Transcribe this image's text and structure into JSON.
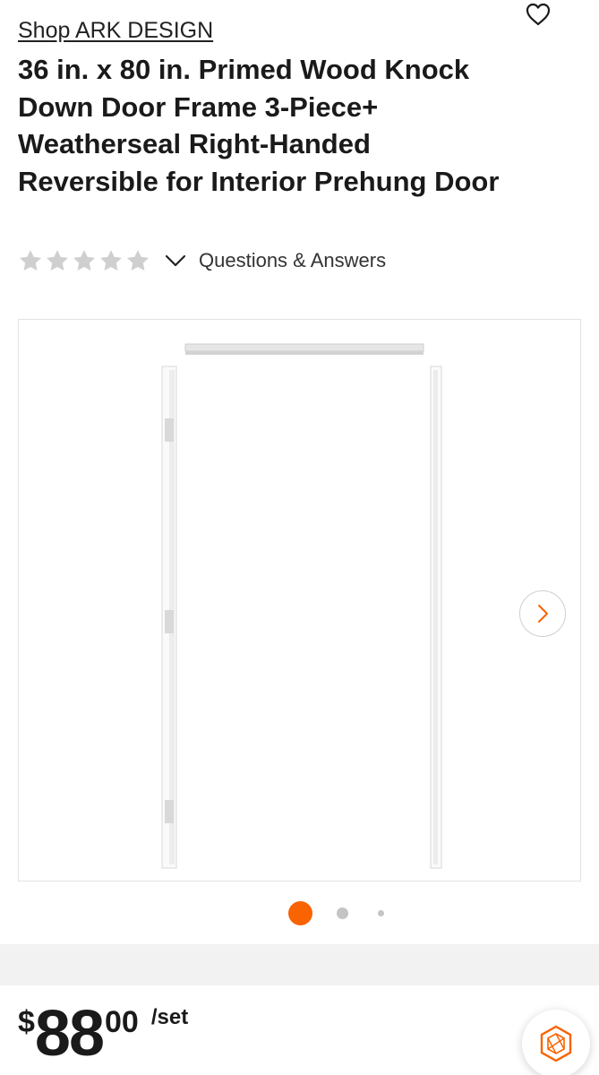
{
  "header": {
    "shop_link": "Shop ARK DESIGN",
    "title": "36 in. x 80 in. Primed Wood Knock Down Door Frame 3-Piece+ Weatherseal Right-Handed Reversible for Interior Prehung Door",
    "rating_stars": 0,
    "qa_link": "Questions & Answers",
    "favorite_icon": "heart-outline-icon"
  },
  "gallery": {
    "image_alt": "Door frame kit product image",
    "total_images": 3,
    "active_index": 0,
    "next_icon": "chevron-right-icon",
    "colors": {
      "active_dot": "#f96302",
      "inactive_dot": "#c4c4c4"
    }
  },
  "pricing": {
    "currency": "$",
    "dollars": "88",
    "cents": "00",
    "unit": "/set"
  },
  "assistant": {
    "icon": "hexagon-assistant-icon",
    "accent": "#f96302"
  }
}
